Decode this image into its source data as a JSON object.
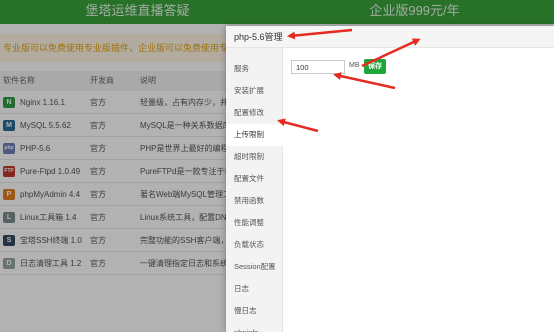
{
  "banner": {
    "left": "堡塔运维直播答疑",
    "right": "企业版999元/年"
  },
  "notice": "专业版可以免费使用专业版插件，企业版可以免费使用专业版及企业版插件",
  "table": {
    "headers": {
      "name": "软件名称",
      "vendor": "开发商",
      "desc": "说明"
    },
    "rows": [
      {
        "name": "Nginx 1.16.1",
        "vendor": "官方",
        "desc": "轻量级，占有内存少，并发能力强",
        "icon": "N",
        "color": "#2f9e44"
      },
      {
        "name": "MySQL 5.5.62",
        "vendor": "官方",
        "desc": "MySQL是一种关系数据库管理系统",
        "icon": "M",
        "color": "#2b6a99"
      },
      {
        "name": "PHP-5.6",
        "vendor": "官方",
        "desc": "PHP是世界上最好的编程语言",
        "icon": "php",
        "color": "#6c7eb7"
      },
      {
        "name": "Pure-Ftpd 1.0.49",
        "vendor": "官方",
        "desc": "PureFTPd是一款专注于程序健壮",
        "icon": "FTP",
        "color": "#c0392b"
      },
      {
        "name": "phpMyAdmin 4.4",
        "vendor": "官方",
        "desc": "著名Web端MySQL管理工具",
        "icon": "P",
        "color": "#e67e22"
      },
      {
        "name": "Linux工具箱 1.4",
        "vendor": "官方",
        "desc": "Linux系统工具，配置DNS、Swap",
        "icon": "L",
        "color": "#7f8c8d"
      },
      {
        "name": "宝塔SSH终端 1.0",
        "vendor": "官方",
        "desc": "完整功能的SSH客户端，仅用于连接",
        "icon": "S",
        "color": "#34495e"
      },
      {
        "name": "日志清理工具 1.2",
        "vendor": "官方",
        "desc": "一键清理指定日志和系统垃圾",
        "icon": "D",
        "color": "#95a5a6"
      }
    ]
  },
  "modal": {
    "title": "php-5.6管理",
    "menu": [
      {
        "label": "服务"
      },
      {
        "label": "安装扩展"
      },
      {
        "label": "配置修改"
      },
      {
        "label": "上传限制"
      },
      {
        "label": "超时限制"
      },
      {
        "label": "配置文件"
      },
      {
        "label": "禁用函数"
      },
      {
        "label": "性能调整"
      },
      {
        "label": "负载状态"
      },
      {
        "label": "Session配置"
      },
      {
        "label": "日志"
      },
      {
        "label": "慢日志"
      },
      {
        "label": "phpinfo"
      }
    ],
    "active_index": 3,
    "upload_limit_value": "100",
    "unit": "MB",
    "save_label": "保存"
  },
  "colors": {
    "accent": "#20a53a",
    "arrow": "#e52b22",
    "banner": "#39a33c"
  }
}
